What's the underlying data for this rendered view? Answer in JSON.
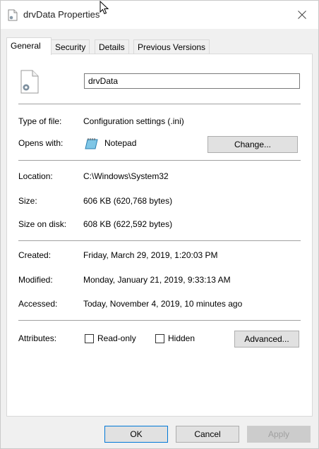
{
  "window": {
    "title": "drvData Properties"
  },
  "tabs": [
    {
      "label": "General"
    },
    {
      "label": "Security"
    },
    {
      "label": "Details"
    },
    {
      "label": "Previous Versions"
    }
  ],
  "general": {
    "file_name": "drvData",
    "type_label": "Type of file:",
    "type_value": "Configuration settings (.ini)",
    "opens_label": "Opens with:",
    "opens_value": "Notepad",
    "change_button": "Change...",
    "location_label": "Location:",
    "location_value": "C:\\Windows\\System32",
    "size_label": "Size:",
    "size_value": "606 KB (620,768 bytes)",
    "size_on_disk_label": "Size on disk:",
    "size_on_disk_value": "608 KB (622,592 bytes)",
    "created_label": "Created:",
    "created_value": "Friday, March 29, 2019, 1:20:03 PM",
    "modified_label": "Modified:",
    "modified_value": "Monday, January 21, 2019, 9:33:13 AM",
    "accessed_label": "Accessed:",
    "accessed_value": "Today, November 4, 2019, 10 minutes ago",
    "attributes_label": "Attributes:",
    "readonly_label": "Read-only",
    "hidden_label": "Hidden",
    "advanced_button": "Advanced..."
  },
  "footer": {
    "ok": "OK",
    "cancel": "Cancel",
    "apply": "Apply"
  },
  "icons": {
    "title": "file-settings-icon",
    "close": "close-icon",
    "file": "file-settings-icon",
    "opens_with": "notepad-icon",
    "cursor": "mouse-pointer-icon"
  }
}
